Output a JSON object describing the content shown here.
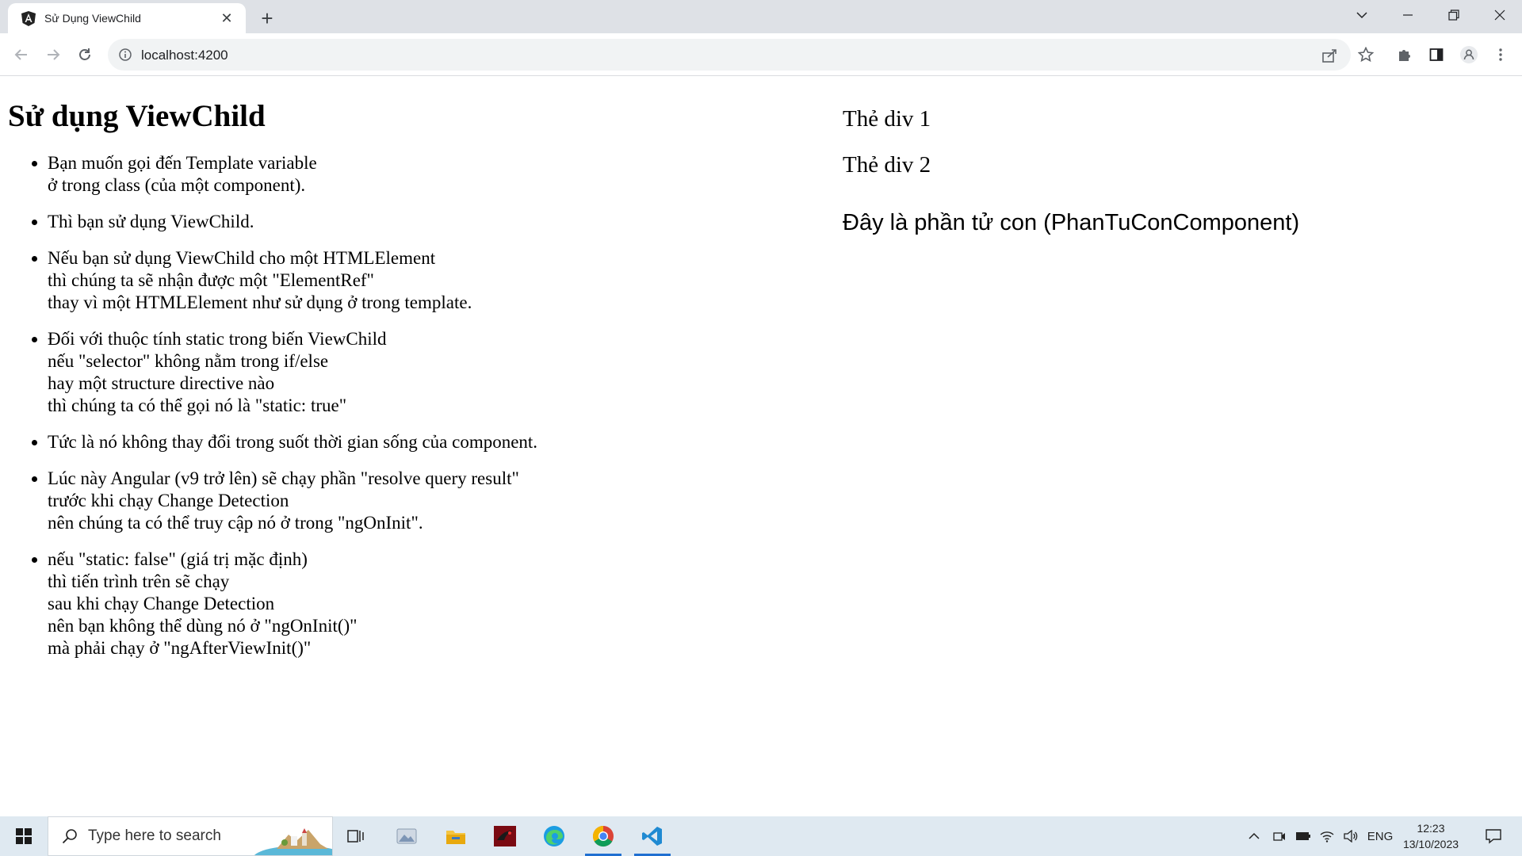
{
  "browser": {
    "tab_title": "Sử Dụng ViewChild",
    "url": "localhost:4200",
    "icons": {
      "favicon": "angular-icon",
      "close": "close-icon",
      "new_tab": "plus-icon",
      "tab_search": "chevron-down-icon",
      "minimize": "minimize-icon",
      "restore": "restore-icon",
      "close_window": "close-icon",
      "back": "arrow-left-icon",
      "forward": "arrow-right-icon",
      "reload": "reload-icon",
      "site_info": "info-icon",
      "share": "share-icon",
      "bookmark": "star-icon",
      "extensions": "puzzle-icon",
      "side_panel": "side-panel-icon",
      "profile": "profile-icon",
      "menu": "kebab-menu-icon"
    }
  },
  "page": {
    "title": "Sử dụng ViewChild",
    "notes": [
      "Bạn muốn gọi đến Template variable\nở trong class (của một component).",
      "Thì bạn sử dụng ViewChild.",
      "Nếu bạn sử dụng ViewChild cho một HTMLElement\nthì chúng ta sẽ nhận được một \"ElementRef\"\nthay vì một HTMLElement như sử dụng ở trong template.",
      "Đối với thuộc tính static trong biến ViewChild\nnếu \"selector\" không nằm trong if/else\nhay một structure directive nào\nthì chúng ta có thể gọi nó là \"static: true\"",
      "Tức là nó không thay đổi trong suốt thời gian sống của component.",
      "Lúc này Angular (v9 trở lên) sẽ chạy phần \"resolve query result\"\ntrước khi chạy Change Detection\nnên chúng ta có thể truy cập nó ở trong \"ngOnInit\".",
      "nếu \"static: false\" (giá trị mặc định)\nthì tiến trình trên sẽ chạy\nsau khi chạy Change Detection\nnên bạn không thể dùng nó ở \"ngOnInit()\"\nmà phải chạy ở \"ngAfterViewInit()\""
    ],
    "div1": "Thẻ div 1",
    "div2": "Thẻ div 2",
    "child_component": "Đây là phần tử con (PhanTuConComponent)"
  },
  "taskbar": {
    "search_placeholder": "Type here to search",
    "language": "ENG",
    "time": "12:23",
    "date": "13/10/2023",
    "apps": [
      "task-view-icon",
      "photos-icon",
      "file-explorer-icon",
      "red-app-icon",
      "edge-icon",
      "chrome-icon",
      "vscode-icon"
    ],
    "active_apps": [
      "chrome-icon",
      "vscode-icon"
    ],
    "tray_icons": [
      "chevron-up-icon",
      "meet-icon",
      "battery-icon",
      "wifi-icon",
      "volume-icon",
      "notification-icon"
    ]
  }
}
